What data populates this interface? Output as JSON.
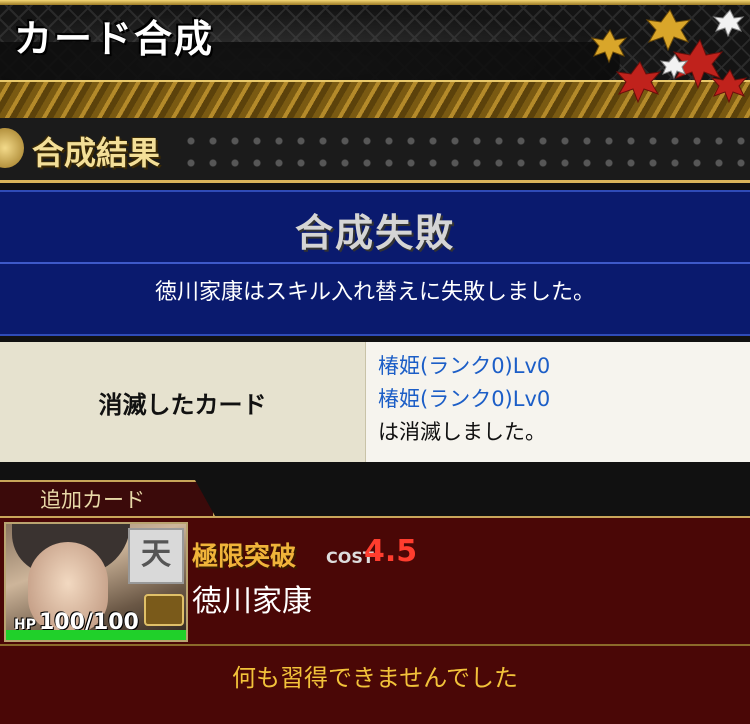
{
  "header": {
    "title": "カード合成"
  },
  "section": {
    "title": "合成結果"
  },
  "result": {
    "title": "合成失敗",
    "message": "徳川家康はスキル入れ替えに失敗しました。"
  },
  "lost_cards": {
    "label": "消滅したカード",
    "items": [
      "椿姫(ランク0)Lv0",
      "椿姫(ランク0)Lv0"
    ],
    "suffix": "は消滅しました。"
  },
  "added_card": {
    "tab_label": "追加カード",
    "rarity_badge": "天",
    "status": "極限突破",
    "cost_label": "COST",
    "cost_value": "4.5",
    "name": "徳川家康",
    "hp_label": "HP",
    "hp": "100/100",
    "hp_fraction": 1.0,
    "learn_result": "何も習得できませんでした"
  },
  "colors": {
    "accent_gold": "#d9b35a",
    "result_blue": "#0a1a6e",
    "link_blue": "#1c5ec7",
    "cost_red": "#ff3d2e"
  }
}
